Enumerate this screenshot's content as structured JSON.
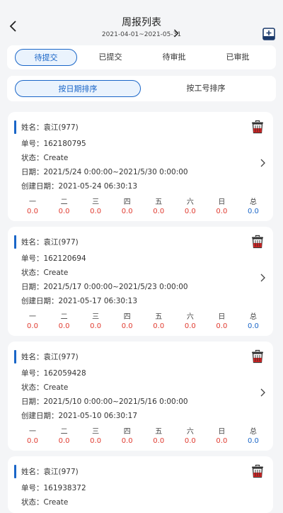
{
  "header": {
    "title": "周报列表",
    "range": "2021-04-01~2021-05-31"
  },
  "tabs": [
    {
      "label": "待提交",
      "active": true
    },
    {
      "label": "已提交",
      "active": false
    },
    {
      "label": "待审批",
      "active": false
    },
    {
      "label": "已审批",
      "active": false
    }
  ],
  "sorts": [
    {
      "label": "按日期排序",
      "active": true
    },
    {
      "label": "按工号排序",
      "active": false
    }
  ],
  "day_labels": [
    "一",
    "二",
    "三",
    "四",
    "五",
    "六",
    "日",
    "总"
  ],
  "cards": [
    {
      "name": "姓名：袁江(977)",
      "order": "单号：162180795",
      "status": "状态：Create",
      "date": "日期：2021/5/24 0:00:00~2021/5/30 0:00:00",
      "created": "创建日期：2021-05-24 06:30:13",
      "values": [
        "0.0",
        "0.0",
        "0.0",
        "0.0",
        "0.0",
        "0.0",
        "0.0",
        "0.0"
      ]
    },
    {
      "name": "姓名：袁江(977)",
      "order": "单号：162120694",
      "status": "状态：Create",
      "date": "日期：2021/5/17 0:00:00~2021/5/23 0:00:00",
      "created": "创建日期：2021-05-17 06:30:13",
      "values": [
        "0.0",
        "0.0",
        "0.0",
        "0.0",
        "0.0",
        "0.0",
        "0.0",
        "0.0"
      ]
    },
    {
      "name": "姓名：袁江(977)",
      "order": "单号：162059428",
      "status": "状态：Create",
      "date": "日期：2021/5/10 0:00:00~2021/5/16 0:00:00",
      "created": "创建日期：2021-05-10 06:30:17",
      "values": [
        "0.0",
        "0.0",
        "0.0",
        "0.0",
        "0.0",
        "0.0",
        "0.0",
        "0.0"
      ]
    },
    {
      "name": "姓名：袁江(977)",
      "order": "单号：161938372",
      "status": "状态：Create",
      "date": "",
      "created": "",
      "values": []
    }
  ],
  "colors": {
    "accent": "#1a66c8",
    "value_red": "#e03c31",
    "background": "#f4f5f7"
  },
  "icons": {
    "back": "chevron-left-icon",
    "next": "chevron-right-icon",
    "add": "add-box-icon",
    "delete": "trash-icon",
    "detail": "chevron-right-icon"
  }
}
